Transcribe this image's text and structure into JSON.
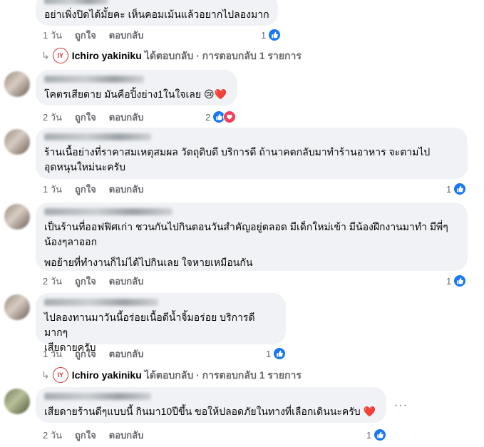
{
  "colors": {
    "bubble_bg": "#f0f2f5",
    "meta_text": "#65676b",
    "like_blue": "#1877f2",
    "love_red": "#f33e58"
  },
  "labels": {
    "like": "ถูกใจ",
    "reply": "ตอบกลับ"
  },
  "comments": [
    {
      "text": "อย่าเพิ่งปิดได้มั้ยคะ เห็นคอมเม้นแล้วอยากไปลองมาก",
      "time": "1 วัน",
      "reaction_count": "1",
      "reactions": [
        "like-icon"
      ]
    },
    {
      "text": "โคตรเสียดาย มันคือปิ้งย่าง1ในใจเลย",
      "emojis": "😢❤️",
      "time": "2 วัน",
      "reaction_count": "2",
      "reactions": [
        "like-icon",
        "love-icon"
      ]
    },
    {
      "text": "ร้านเนื้อย่างที่ราคาสมเหตุสมผล วัตถุดิบดี บริการดี ถ้านาคตกลับมาทำร้านอาหาร จะตามไป\nอุดหนุนใหม่นะครับ",
      "time": "1 วัน",
      "reaction_count": "1",
      "reactions": [
        "like-icon"
      ]
    },
    {
      "text": "เป็นร้านที่ออฟฟิศเก่า ชวนกันไปกินตอนวันสำคัญอยู่ตลอด มีเด็กใหม่เข้า มีน้องฝึกงานมาทำ มีพี่ๆ\nน้องๆลาออก",
      "text2": "พอย้ายที่ทำงานก็ไม่ได้ไปกินเลย ใจหายเหมือนกัน",
      "time": "2 วัน",
      "reaction_count": "1",
      "reactions": [
        "like-icon"
      ]
    },
    {
      "text": "ไปลองทานมาวันนี้อร่อยเนื้อดีน้ำจิ้มอร่อย บริการดีมากๆ\nเสียดายครับ",
      "time": "1 วัน",
      "reaction_count": "1",
      "reactions": [
        "like-icon"
      ]
    },
    {
      "text": "เสียดายร้านดีๆแบบนี้ กินมา10ปีขึ้น ขอให้ปลอดภัยในทางที่เลือกเดินนะครับ",
      "emojis": "❤️",
      "time": "2 วัน",
      "reaction_count": "1",
      "reactions": [
        "like-icon"
      ]
    }
  ],
  "replies": [
    {
      "page_name": "Ichiro yakiniku",
      "rest": "ได้ตอบกลับ · การตอบกลับ 1 รายการ"
    },
    {
      "page_name": "Ichiro yakiniku",
      "rest": "ได้ตอบกลับ · การตอบกลับ 1 รายการ"
    }
  ],
  "more_options": "···"
}
